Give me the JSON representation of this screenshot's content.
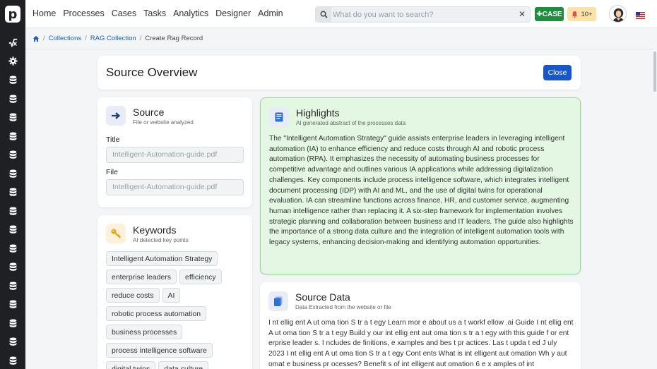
{
  "nav": [
    "Home",
    "Processes",
    "Cases",
    "Tasks",
    "Analytics",
    "Designer",
    "Admin"
  ],
  "search": {
    "placeholder": "What do you want to search?"
  },
  "case_button": "CASE",
  "notifications": "10+",
  "breadcrumb": [
    "Collections",
    "RAG Collection",
    "Create Rag Record"
  ],
  "overview": {
    "title": "Source Overview",
    "close_label": "Close"
  },
  "source": {
    "title": "Source",
    "subtitle": "File or website analyzed",
    "title_label": "Title",
    "title_value": "Intelligent-Automation-guide.pdf",
    "file_label": "File",
    "file_value": "Intelligent-Automation-guide.pdf"
  },
  "keywords": {
    "title": "Keywords",
    "subtitle": "AI detected key points",
    "items": [
      "Intelligent Automation Strategy",
      "enterprise leaders",
      "efficiency",
      "reduce costs",
      "AI",
      "robotic process automation",
      "business processes",
      "process intelligence software",
      "digital twins",
      "data culture"
    ]
  },
  "highlights": {
    "title": "Highlights",
    "subtitle": "AI generated abstract of the processes data",
    "text": "The \"Intelligent Automation Strategy\" guide assists enterprise leaders in leveraging intelligent automation (IA) to enhance efficiency and reduce costs through AI and robotic process automation (RPA). It emphasizes the necessity of automating business processes for competitive advantage and outlines various IA applications while addressing digitalization challenges. Key components include process intelligence software, which integrates intelligent document processing (IDP) with AI and ML, and the use of digital twins for operational evaluation. IA can streamline functions across finance, HR, and customer service, augmenting human intelligence rather than replacing it. A six-step framework for implementation involves strategic planning and collaboration between business and IT leaders. The guide also highlights the importance of a strong data culture and the integration of intelligent automation tools with legacy systems, enhancing decision-making and identifying automation opportunities."
  },
  "source_data": {
    "title": "Source Data",
    "subtitle": "Data Extracted from the website or file",
    "text": "I nt ellig ent A ut oma tion S tr a t egy Learn mor e about us a t workf ellow .ai Guide I nt ellig ent A ut oma tion S tr a t egy Build y our int ellig ent aut oma tion s tr a t egy with this guide f or ent erprise leader s. I ncludes de finitions, e xamples and bes t pr actices. Las t upda t ed J uly 2023 I nt ellig ent A ut oma tion S tr a t egy Cont ents What is int elligent aut omation Wh y aut omat e business pr ocesses? Benefit s of int elligent aut omation 6 e x amples of int"
  }
}
